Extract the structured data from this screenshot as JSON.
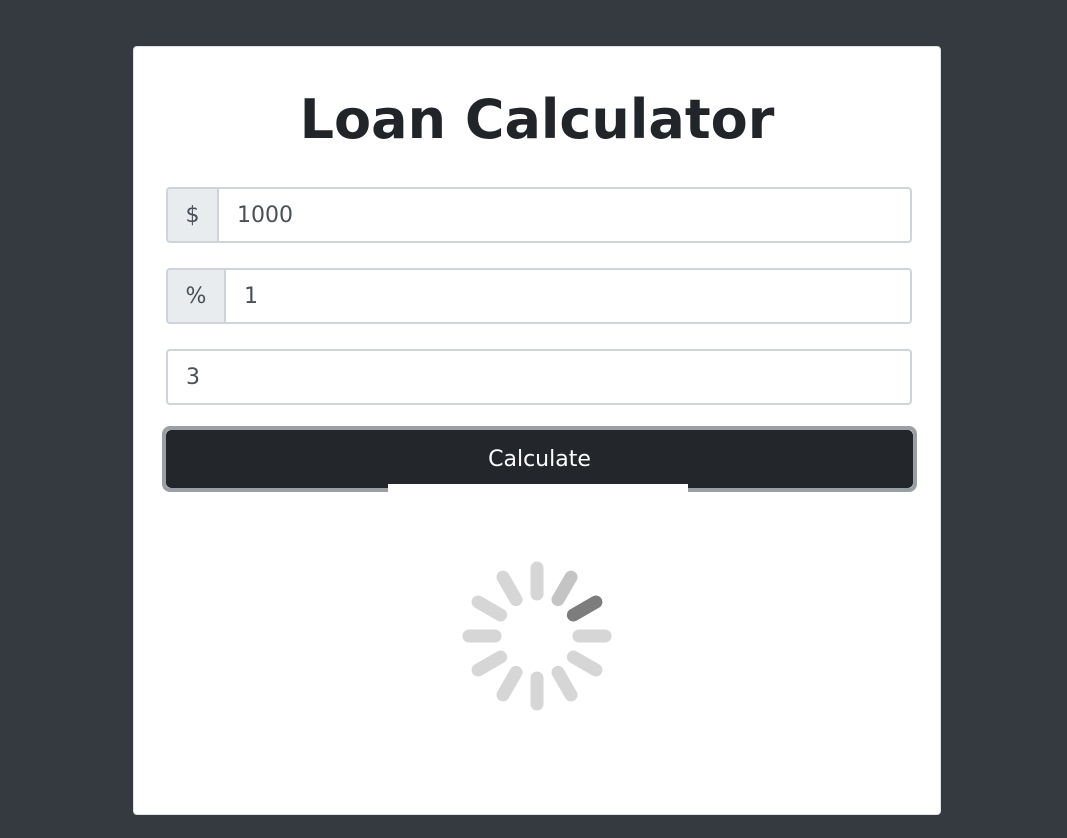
{
  "page": {
    "title": "Loan Calculator"
  },
  "form": {
    "amount": {
      "addon": "$",
      "value": "1000"
    },
    "interest": {
      "addon": "%",
      "value": "1"
    },
    "years": {
      "value": "3"
    },
    "calculate_label": "Calculate"
  },
  "spinner": {
    "icon": "loading-spinner-icon"
  },
  "colors": {
    "page_background": "#343a40",
    "card_background": "#ffffff",
    "button_background": "#23272b",
    "title_text": "#212529"
  }
}
